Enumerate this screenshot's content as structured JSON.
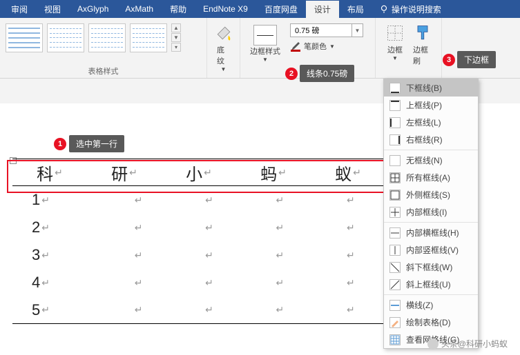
{
  "ribbon": {
    "tabs": [
      "审阅",
      "视图",
      "AxGlyph",
      "AxMath",
      "帮助",
      "EndNote X9",
      "百度网盘",
      "设计",
      "布局"
    ],
    "active_tab": "设计",
    "help_text": "操作说明搜索"
  },
  "groups": {
    "table_styles": "表格样式",
    "shading": "底纹",
    "border_style": "边框样式",
    "line_weight": "0.75 磅",
    "pen_color": "笔颜色",
    "borders_group": "边框",
    "border_btn": "边框",
    "border_painter": "边框刷"
  },
  "tooltips": {
    "select_first_row": "选中第一行",
    "line_weight_hint": "线条0.75磅",
    "bottom_border": "下边框"
  },
  "badges": {
    "b1": "1",
    "b2": "2",
    "b3": "3"
  },
  "dropdown": {
    "items": [
      {
        "label": "下框线(B)",
        "icon": "bottom"
      },
      {
        "label": "上框线(P)",
        "icon": "top"
      },
      {
        "label": "左框线(L)",
        "icon": "left"
      },
      {
        "label": "右框线(R)",
        "icon": "right"
      },
      {
        "sep": true
      },
      {
        "label": "无框线(N)",
        "icon": "none"
      },
      {
        "label": "所有框线(A)",
        "icon": "all"
      },
      {
        "label": "外侧框线(S)",
        "icon": "outside"
      },
      {
        "label": "内部框线(I)",
        "icon": "inside"
      },
      {
        "sep": true
      },
      {
        "label": "内部横框线(H)",
        "icon": "h"
      },
      {
        "label": "内部竖框线(V)",
        "icon": "v"
      },
      {
        "label": "斜下框线(W)",
        "icon": "diag1"
      },
      {
        "label": "斜上框线(U)",
        "icon": "diag2"
      },
      {
        "sep": true
      },
      {
        "label": "横线(Z)",
        "icon": "hr"
      },
      {
        "label": "绘制表格(D)",
        "icon": "draw"
      },
      {
        "label": "查看网格线(G)",
        "icon": "grid"
      }
    ]
  },
  "table_data": {
    "header": [
      "科",
      "研",
      "小",
      "蚂",
      "蚁"
    ],
    "rows": [
      "1",
      "2",
      "3",
      "4",
      "5"
    ]
  },
  "watermark": "头条@科研小蚂蚁"
}
